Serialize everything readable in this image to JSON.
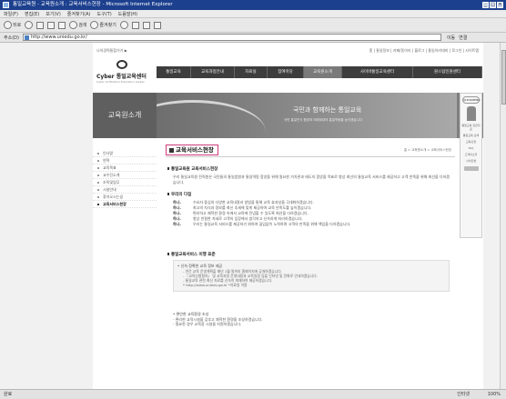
{
  "window": {
    "title": "통일교육원 - 교육원소개 : 교육서비스현장 - Microsoft Internet Explorer",
    "buttons": [
      "_",
      "□",
      "×"
    ]
  },
  "menubar": [
    "파일(F)",
    "편집(E)",
    "보기(V)",
    "즐겨찾기(A)",
    "도구(T)",
    "도움말(H)"
  ],
  "toolbar": {
    "back": "뒤로",
    "search": "검색",
    "favorites": "즐겨찾기"
  },
  "address": {
    "label": "주소(D)",
    "url": "http://www.uniedu.go.kr/",
    "go": "이동",
    "links": "연결"
  },
  "site": {
    "toplinks_left": "나의경력통합가기 ▶",
    "toplinks_right": "홈 | 통일정보 | 카페/동아리 | 블로그 | 통일아카데미 | 로그인 | 사이트맵",
    "logo_name": "Cyber 통일교육센터",
    "logo_sub": "Cyber Unification Education Center",
    "gnb": [
      "통일교육",
      "교육과정안내",
      "자료실",
      "참여마당",
      "교육원소개",
      "사이버통일교육센터",
      "원스탑민원센터"
    ],
    "left_visual": "교육원소개",
    "banner_slogan": "국민과 함께하는 통일교육",
    "banner_sub": "국민 통일인식 함양과 미래세대의 통일역량을 높이겠습니다"
  },
  "quickmenu": {
    "head": "QUICKMENU",
    "items": [
      "통일교육 관련자료",
      "통일교육 검색",
      "교육신청",
      "FAQ",
      "고객의소리",
      "사이트맵"
    ]
  },
  "lnb": {
    "items": [
      "인사말",
      "연혁",
      "교육목표",
      "교수진소개",
      "조직및업무",
      "시설안내",
      "찾아오시는길",
      "교육서비스현장"
    ],
    "selected": 7
  },
  "content": {
    "title": "교육서비스현장",
    "breadcrumb": "홈 > 교육원소개 > 교육서비스현장",
    "sec1_head": "통일교육원 교육서비스현장",
    "sec1_body": "우리 통일교육원 전직원은 국민들의 통일염원과 통일역량 함양을 위해 필요한 가치관과 태도의 함양을 목표로 항상 최선의 통일교육 서비스를 제공하고 고객 만족을 위해 최선을 다하겠습니다.",
    "sec2_head": "우리의 다짐",
    "pledges": [
      {
        "k": "하나.",
        "v": "수요자 중심의 다양한 교육내용과 방법을 통해 교육 효과성을 극대화하겠습니다."
      },
      {
        "k": "하나.",
        "v": "최고의 지식과 정보를 최신 추세에 맞게 제공하여 교육 만족도를 높이겠습니다."
      },
      {
        "k": "하나.",
        "v": "편리하고 쾌적한 환경 속에서 교육에 전념할 수 있도록 최선을 다하겠습니다."
      },
      {
        "k": "하나.",
        "v": "항상 친절한 자세로 고객의 입장에서 생각하고 신속하게 처리하겠습니다."
      },
      {
        "k": "하나.",
        "v": "우리는 통일교육 서비스를 제공하기 위하여 끊임없이 노력하며 고객의 만족을 위해 책임을 다하겠습니다."
      }
    ],
    "sec3_head": "통일교육서비스 이행 표준",
    "box_title": "• 신속·정확한 교육 정보 제공",
    "box_lines": [
      "- 연간 교육 운영계획을 매년 1월 말까지 홈페이지에 공개하겠습니다.",
      "- 『교육신청절차』 및 교육과정 운영내용과 교육일정 등을 인터넷 및 전화로 안내하겠습니다.",
      "- 통일교육 관련 최신 자료를 신속히 게재하여 제공하겠습니다.",
      "* http://www.uniedu.go.kr  *자료실 이용"
    ],
    "sec4_head": "• 편안한 교육환경 조성",
    "sec4_lines": [
      "- 편리한 교육시설을 갖추고 쾌적한 환경을 조성하겠습니다.",
      "- 필요한 경우 교육장 시설을 지원하겠습니다."
    ]
  },
  "status": {
    "left": "완료",
    "zone": "인터넷",
    "zoom": "100%"
  }
}
